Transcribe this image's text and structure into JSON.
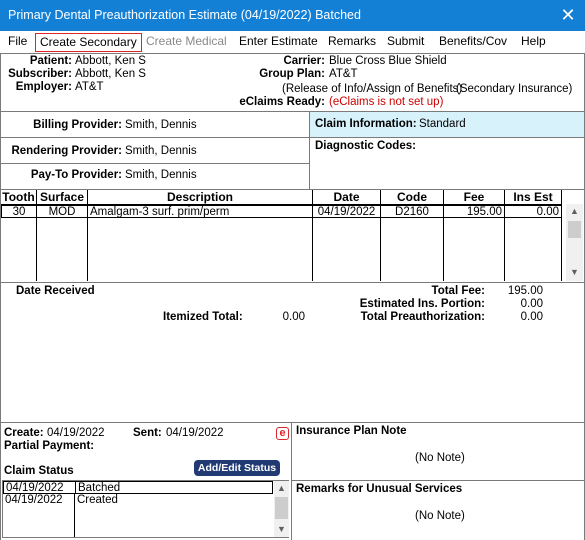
{
  "window": {
    "title": "Primary Dental Preauthorization Estimate (04/19/2022) Batched",
    "close_glyph": "✕"
  },
  "menu": [
    {
      "label": "File"
    },
    {
      "label": "Create Secondary"
    },
    {
      "label": "Create Medical"
    },
    {
      "label": "Enter Estimate"
    },
    {
      "label": "Remarks"
    },
    {
      "label": "Submit"
    },
    {
      "label": "Benefits/Cov"
    },
    {
      "label": "Help"
    }
  ],
  "patient_info": {
    "patient_label": "Patient:",
    "patient": "Abbott, Ken S",
    "subscriber_label": "Subscriber:",
    "subscriber": "Abbott, Ken S",
    "employer_label": "Employer:",
    "employer": "AT&T",
    "carrier_label": "Carrier:",
    "carrier": "Blue Cross Blue Shield",
    "group_plan_label": "Group Plan:",
    "group_plan": "AT&T",
    "release_info": "(Release of Info/Assign of Benefits)",
    "secondary_insurance": "(Secondary Insurance)",
    "eclaims_label": "eClaims Ready:",
    "eclaims_status": "(eClaims is not set up)"
  },
  "providers": {
    "billing_label": "Billing Provider:",
    "billing": "Smith, Dennis",
    "rendering_label": "Rendering Provider:",
    "rendering": "Smith, Dennis",
    "payto_label": "Pay-To Provider:",
    "payto": "Smith, Dennis"
  },
  "claim_info": {
    "label": "Claim Information:",
    "value": "Standard",
    "diagnostic_label": "Diagnostic Codes:"
  },
  "procedures": {
    "headers": {
      "tooth": "Tooth",
      "surface": "Surface",
      "description": "Description",
      "date": "Date",
      "code": "Code",
      "fee": "Fee",
      "ins_est": "Ins Est"
    },
    "rows": [
      {
        "tooth": "30",
        "surface": "MOD",
        "description": "Amalgam-3 surf. prim/perm",
        "date": "04/19/2022",
        "code": "D2160",
        "fee": "195.00",
        "ins_est": "0.00"
      }
    ]
  },
  "totals": {
    "date_received_label": "Date Received",
    "total_fee_label": "Total Fee:",
    "total_fee": "195.00",
    "est_ins_label": "Estimated Ins. Portion:",
    "est_ins": "0.00",
    "itemized_label": "Itemized Total:",
    "itemized": "0.00",
    "total_preauth_label": "Total Preauthorization:",
    "total_preauth": "0.00"
  },
  "claim_status": {
    "create_label": "Create:",
    "create_date": "04/19/2022",
    "sent_label": "Sent:",
    "sent_date": "04/19/2022",
    "partial_payment_label": "Partial Payment:",
    "status_label": "Claim Status",
    "button": "Add/Edit Status",
    "eclaim_icon_glyph": "e",
    "rows": [
      {
        "date": "04/19/2022",
        "status": "Batched"
      },
      {
        "date": "04/19/2022",
        "status": "Created"
      }
    ]
  },
  "notes": {
    "insurance_plan_note_label": "Insurance Plan Note",
    "insurance_plan_note": "(No Note)",
    "remarks_label": "Remarks for Unusual Services",
    "remarks": "(No Note)"
  },
  "colors": {
    "titlebar": "#1380d6",
    "highlight": "#d9262b",
    "claim_info_bg": "#d8f2fb",
    "button": "#213a73",
    "eclaims_red": "#cc0000"
  }
}
